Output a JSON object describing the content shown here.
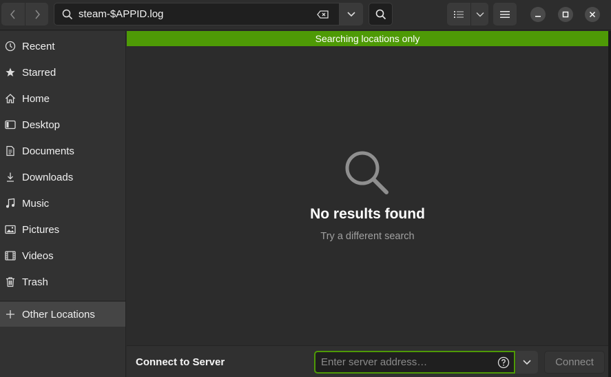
{
  "header": {
    "search_query": "steam-$APPID.log",
    "nav_back_icon": "chevron-left-icon",
    "nav_forward_icon": "chevron-right-icon",
    "window_controls": [
      "minimize",
      "maximize",
      "close"
    ]
  },
  "banner": {
    "text": "Searching locations only",
    "color": "#4e9a06"
  },
  "sidebar": {
    "items": [
      {
        "label": "Recent",
        "icon": "clock-icon"
      },
      {
        "label": "Starred",
        "icon": "star-icon"
      },
      {
        "label": "Home",
        "icon": "home-icon"
      },
      {
        "label": "Desktop",
        "icon": "desktop-icon"
      },
      {
        "label": "Documents",
        "icon": "document-icon"
      },
      {
        "label": "Downloads",
        "icon": "download-icon"
      },
      {
        "label": "Music",
        "icon": "music-icon"
      },
      {
        "label": "Pictures",
        "icon": "picture-icon"
      },
      {
        "label": "Videos",
        "icon": "video-icon"
      },
      {
        "label": "Trash",
        "icon": "trash-icon"
      }
    ],
    "other_locations": {
      "label": "Other Locations",
      "icon": "plus-icon"
    }
  },
  "main": {
    "empty_title": "No results found",
    "empty_subtitle": "Try a different search"
  },
  "footer": {
    "connect_label": "Connect to Server",
    "server_placeholder": "Enter server address…",
    "connect_button": "Connect"
  }
}
